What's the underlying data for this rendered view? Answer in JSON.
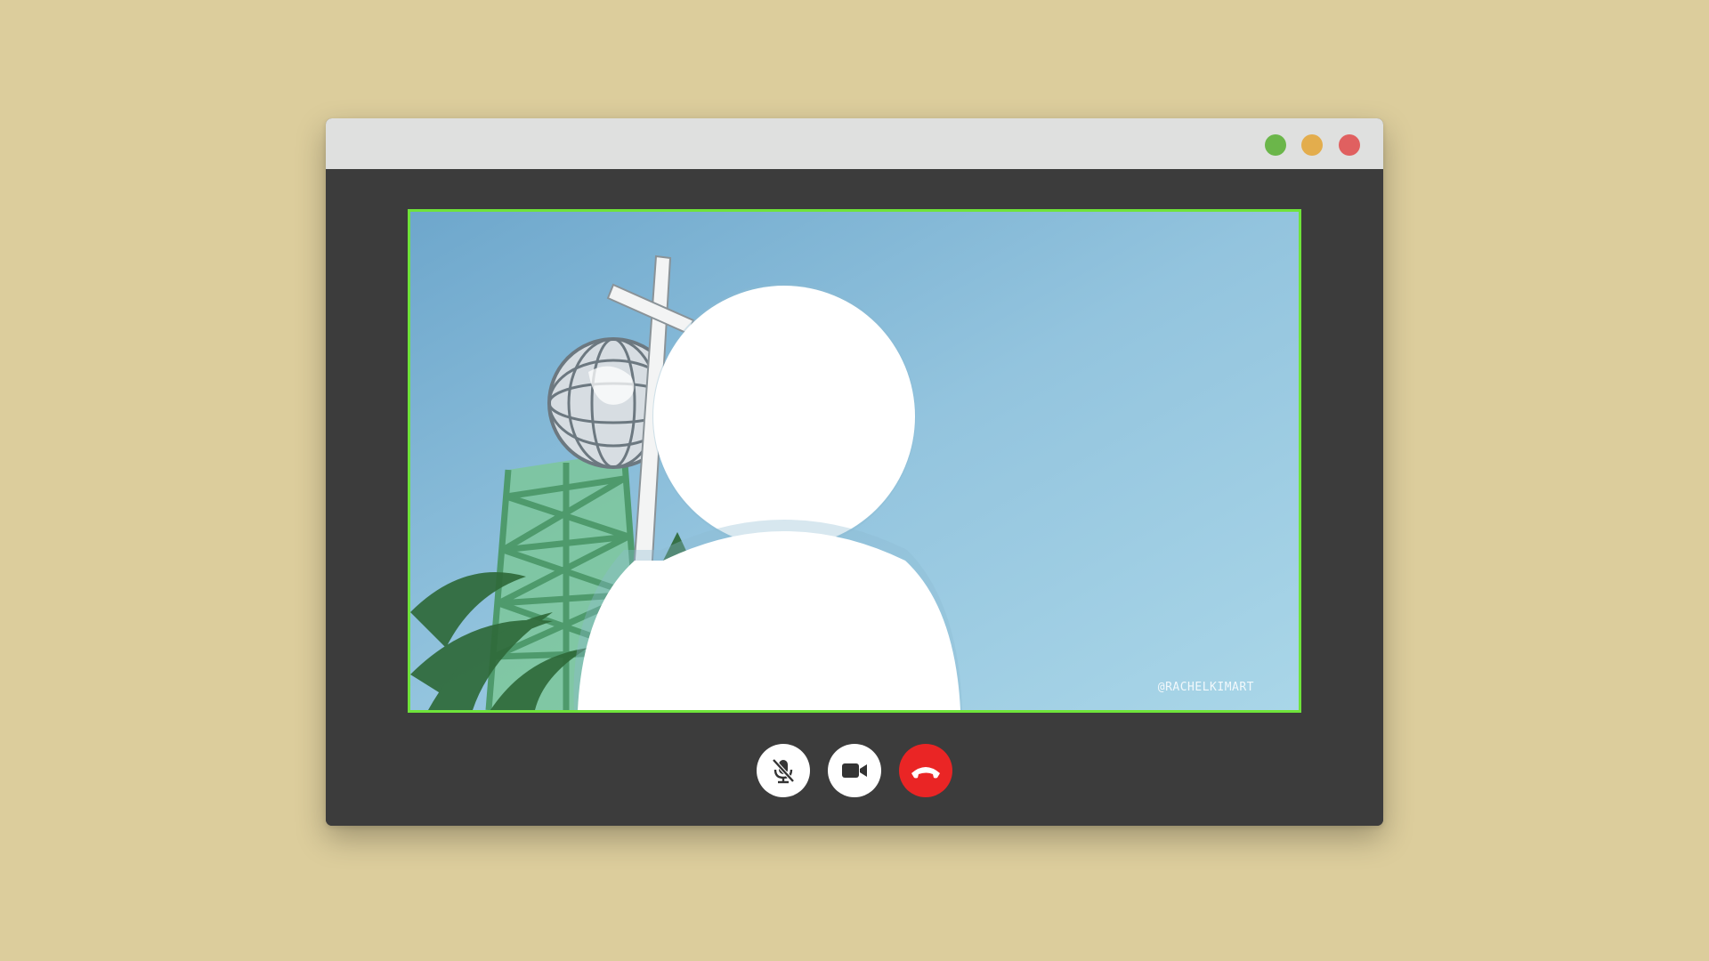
{
  "window": {
    "traffic_lights": [
      {
        "name": "green",
        "color": "#6bb64a"
      },
      {
        "name": "yellow",
        "color": "#e3ad4d"
      },
      {
        "name": "red",
        "color": "#e06060"
      }
    ]
  },
  "video": {
    "border_color": "#6fe33a",
    "watermark": "@RACHELKIMART",
    "avatar_icon": "user-silhouette-icon"
  },
  "controls": {
    "mute": {
      "icon": "mic-off-icon"
    },
    "camera": {
      "icon": "video-camera-icon"
    },
    "end_call": {
      "icon": "phone-hangup-icon",
      "color": "#ea2525"
    }
  }
}
